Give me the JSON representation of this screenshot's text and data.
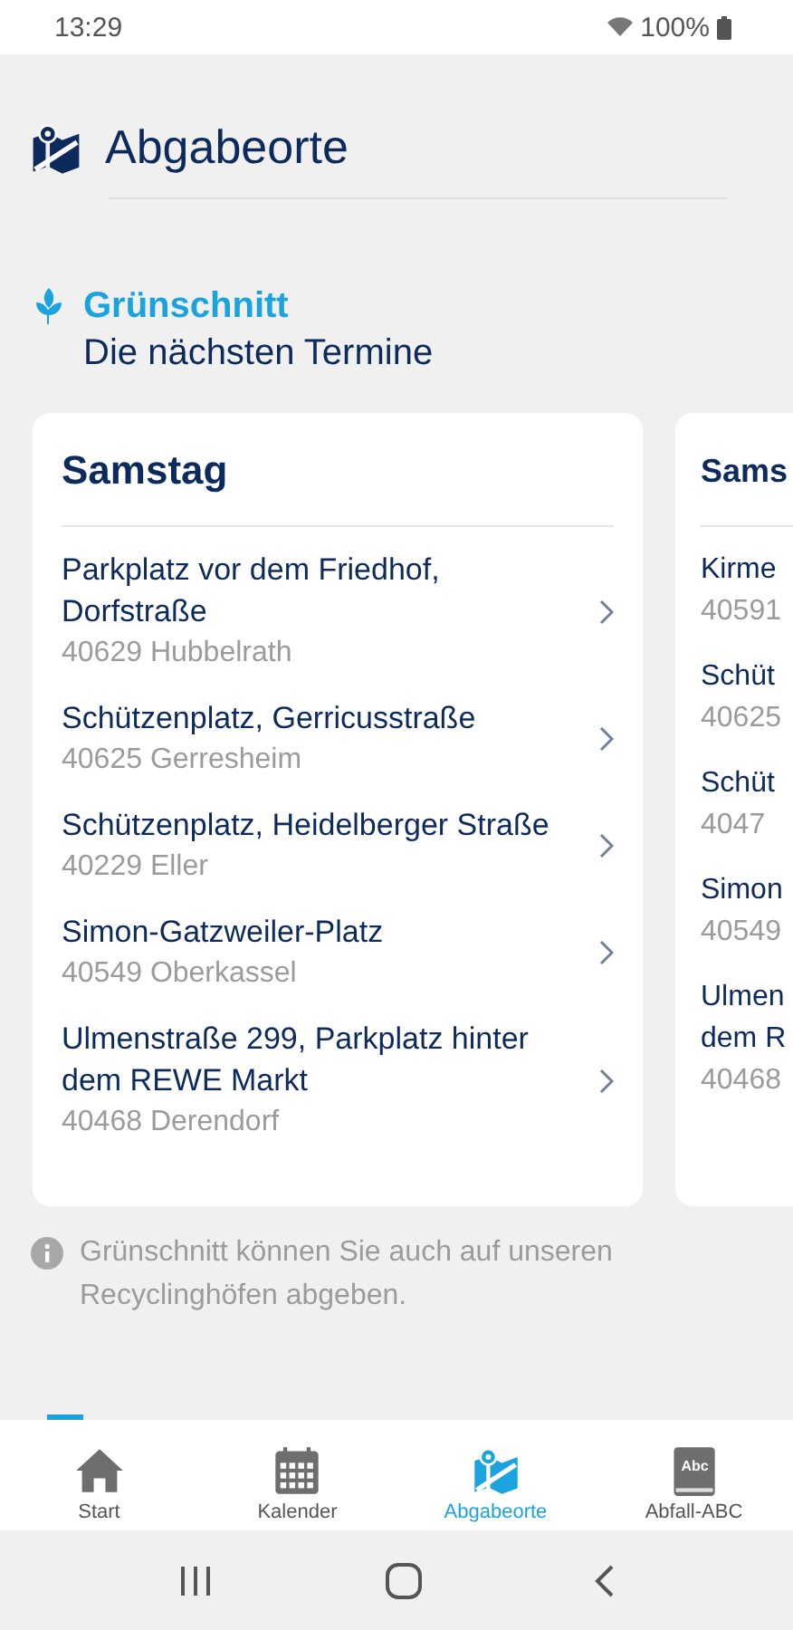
{
  "status_bar": {
    "time": "13:29",
    "battery": "100%"
  },
  "header": {
    "title": "Abgabeorte"
  },
  "section": {
    "title": "Grünschnitt",
    "subtitle": "Die nächsten Termine"
  },
  "cards": [
    {
      "day": "Samstag",
      "cut_off": false,
      "places": [
        {
          "name": "Parkplatz vor dem Friedhof, Dorfstraße",
          "area": "40629 Hubbelrath"
        },
        {
          "name": "Schützenplatz, Gerricusstraße",
          "area": "40625 Gerresheim"
        },
        {
          "name": "Schützenplatz, Heidelberger Straße",
          "area": "40229 Eller"
        },
        {
          "name": "Simon-Gatzweiler-Platz",
          "area": "40549 Oberkassel"
        },
        {
          "name": "Ulmenstraße 299, Parkplatz hinter dem REWE Markt",
          "area": "40468 Derendorf"
        }
      ]
    },
    {
      "day": "Sams",
      "cut_off": true,
      "places": [
        {
          "name": "Kirme",
          "area": "40591"
        },
        {
          "name": "Schüt",
          "area": "40625"
        },
        {
          "name": "Schüt",
          "area": "4047"
        },
        {
          "name": "Simon",
          "area": "40549"
        },
        {
          "name": "Ulmen\ndem R",
          "area": "40468"
        }
      ]
    }
  ],
  "note": "Grünschnitt können Sie auch auf unseren Recyclinghöfen abgeben.",
  "nav": [
    {
      "label": "Start",
      "selected": false
    },
    {
      "label": "Kalender",
      "selected": false
    },
    {
      "label": "Abgabeorte",
      "selected": true
    },
    {
      "label": "Abfall-ABC",
      "icon_text": "Abc",
      "selected": false
    }
  ]
}
